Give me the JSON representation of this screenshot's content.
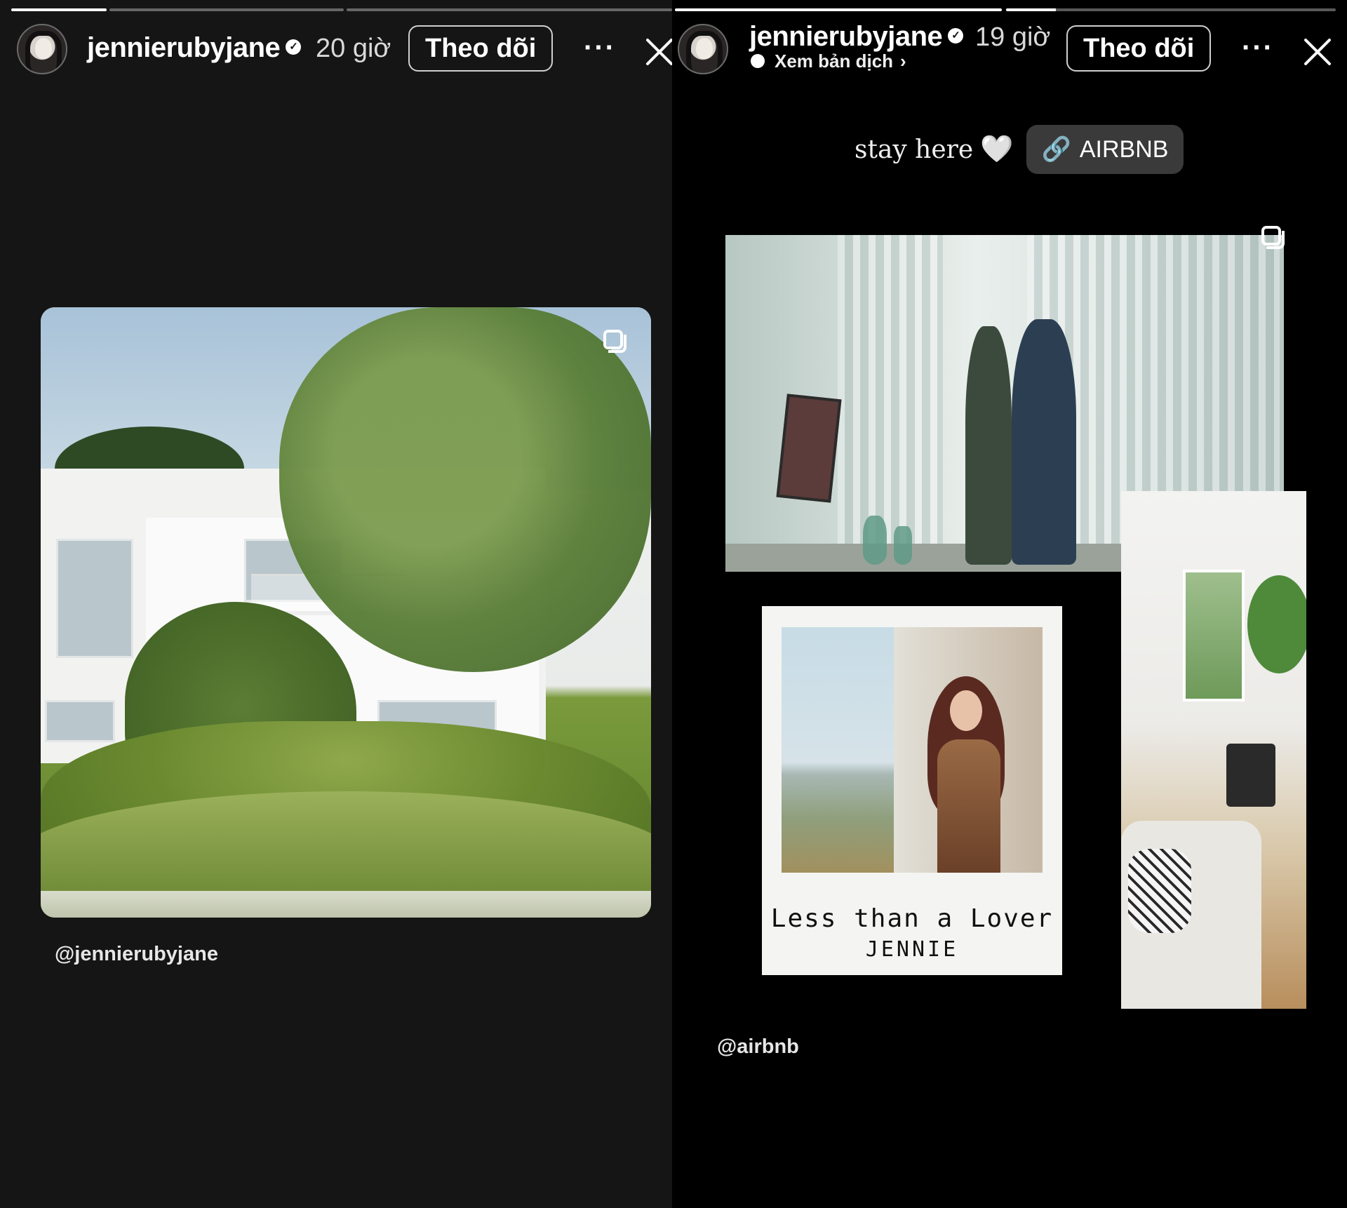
{
  "left_story": {
    "progress": [
      1,
      0,
      0
    ],
    "username": "jennierubyjane",
    "time": "20 giờ",
    "follow_label": "Theo dõi",
    "more_label": "···",
    "mention": "@jennierubyjane",
    "post_image": "villa-garden-photo"
  },
  "right_story": {
    "progress": [
      1,
      0.15
    ],
    "username": "jennierubyjane",
    "time": "19 giờ",
    "translate_label": "Xem bản dịch",
    "follow_label": "Theo dõi",
    "more_label": "···",
    "caption": "stay here",
    "heart": "🤍",
    "link_label": "AIRBNB",
    "polaroid_title": "Less than a Lover",
    "polaroid_artist": "JENNIE",
    "mention": "@airbnb"
  },
  "colors": {
    "left_background": "#151515",
    "right_background": "#000000",
    "link_pill": "#3a3a3a"
  }
}
